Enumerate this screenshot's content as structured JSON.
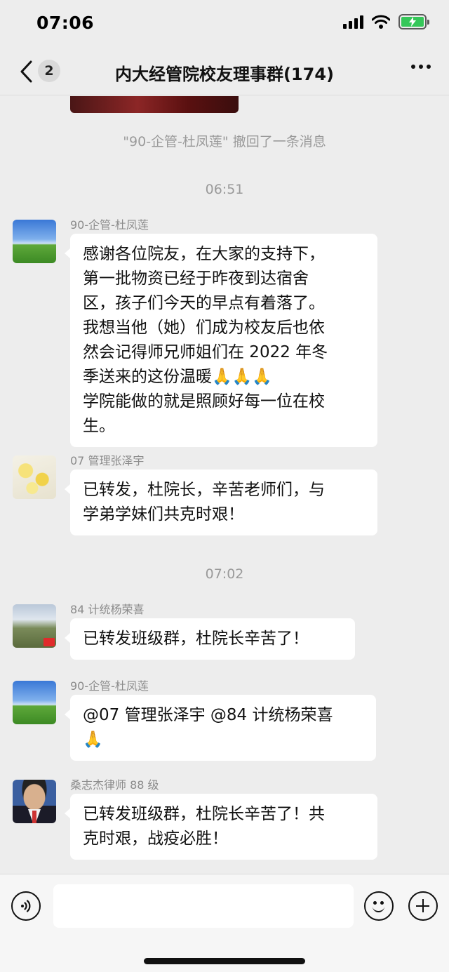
{
  "status_bar": {
    "time": "07:06",
    "icons": [
      "signal-icon",
      "wifi-icon",
      "battery-charging-icon"
    ],
    "battery_color": "#35c759"
  },
  "nav": {
    "back_icon": "chevron-left-icon",
    "unread_count": "2",
    "title": "内大经管院校友理事群(174)",
    "more_icon": "more-icon"
  },
  "chat": {
    "system_message": "\"90-企管-杜凤莲\" 撤回了一条消息",
    "timestamps": [
      "06:51",
      "07:02"
    ],
    "messages": [
      {
        "sender": "90-企管-杜凤莲",
        "lines": [
          "感谢各位院友，在大家的支持下，",
          "第一批物资已经于昨夜到达宿舍",
          "区，孩子们今天的早点有着落了。",
          "我想当他（她）们成为校友后也依",
          "然会记得师兄师姐们在 2022 年冬",
          "季送来的这份温暖🙏🙏🙏",
          "学院能做的就是照顾好每一位在校",
          "生。"
        ]
      },
      {
        "sender": "07 管理张泽宇",
        "lines": [
          "已转发，杜院长，辛苦老师们，与",
          "学弟学妹们共克时艰！"
        ]
      },
      {
        "sender": "84 计统杨荣喜",
        "lines": [
          "已转发班级群，杜院长辛苦了！"
        ]
      },
      {
        "sender": "90-企管-杜凤莲",
        "lines": [
          "@07 管理张泽宇 @84 计统杨荣喜",
          "🙏"
        ]
      },
      {
        "sender": "桑志杰律师 88 级",
        "lines": [
          "已转发班级群，杜院长辛苦了！共",
          "克时艰，战疫必胜！"
        ]
      }
    ]
  },
  "input_bar": {
    "voice_icon": "voice-icon",
    "emoji_icon": "emoji-icon",
    "plus_icon": "plus-icon"
  }
}
